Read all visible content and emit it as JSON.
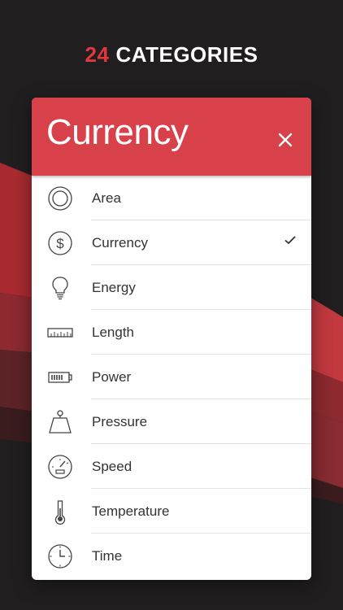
{
  "headline": {
    "count": "24",
    "text": "CATEGORIES"
  },
  "colors": {
    "accent": "#d8414a",
    "headline_number": "#e0383e",
    "background": "#1f1d1e"
  },
  "dialog": {
    "title": "Currency",
    "close_icon": "close-icon",
    "selected": "Currency",
    "items": [
      {
        "label": "Area",
        "icon": "area-icon"
      },
      {
        "label": "Currency",
        "icon": "currency-icon",
        "selected": true
      },
      {
        "label": "Energy",
        "icon": "energy-icon"
      },
      {
        "label": "Length",
        "icon": "length-icon"
      },
      {
        "label": "Power",
        "icon": "power-icon"
      },
      {
        "label": "Pressure",
        "icon": "pressure-icon"
      },
      {
        "label": "Speed",
        "icon": "speed-icon"
      },
      {
        "label": "Temperature",
        "icon": "temperature-icon"
      },
      {
        "label": "Time",
        "icon": "time-icon"
      }
    ]
  }
}
